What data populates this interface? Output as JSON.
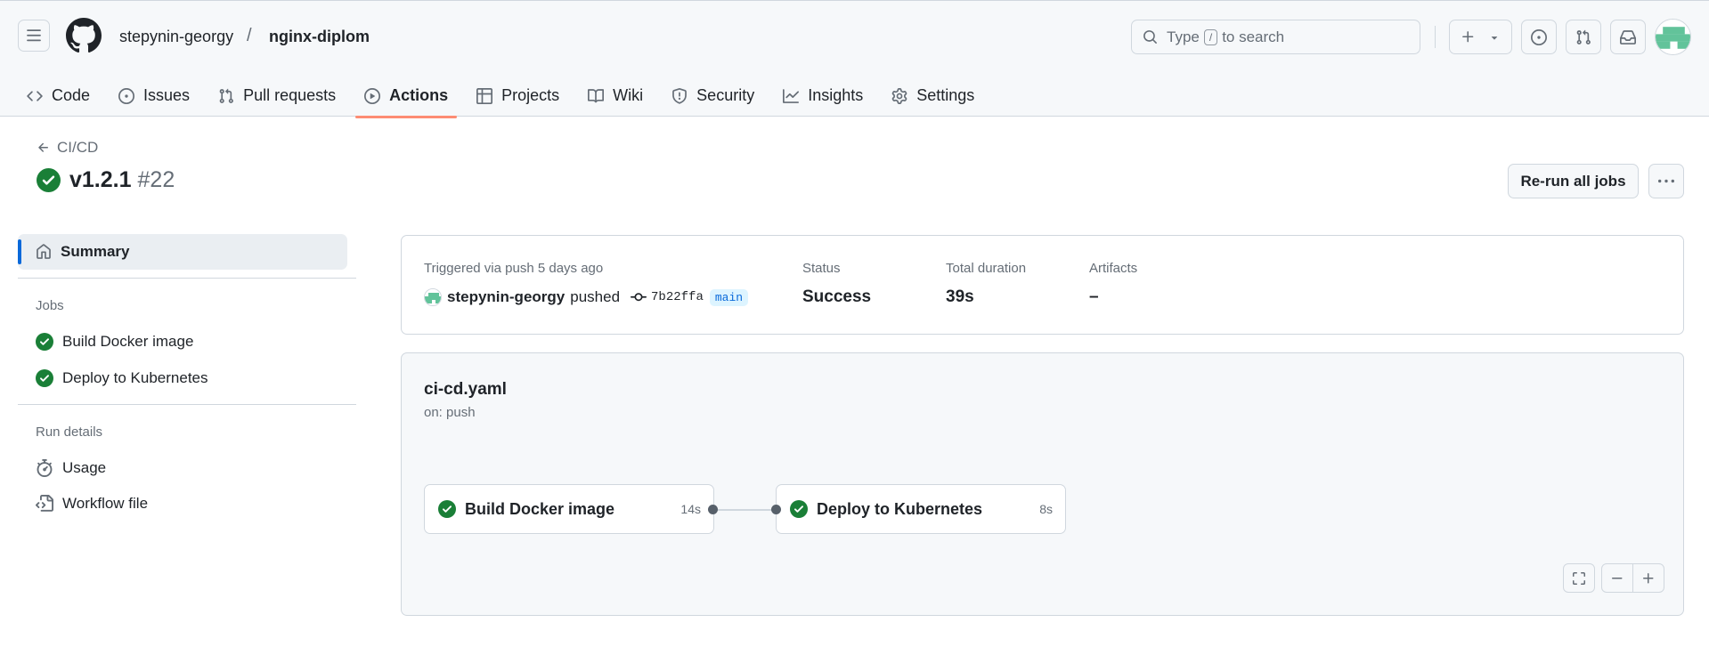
{
  "header": {
    "owner": "stepynin-georgy",
    "separator": "/",
    "repo": "nginx-diplom",
    "search": {
      "prefix": "Type",
      "key": "/",
      "suffix": "to search"
    }
  },
  "tabs": [
    {
      "label": "Code",
      "icon": "code-icon"
    },
    {
      "label": "Issues",
      "icon": "issue-opened-icon"
    },
    {
      "label": "Pull requests",
      "icon": "git-pull-request-icon"
    },
    {
      "label": "Actions",
      "icon": "play-icon",
      "active": true
    },
    {
      "label": "Projects",
      "icon": "table-icon"
    },
    {
      "label": "Wiki",
      "icon": "book-icon"
    },
    {
      "label": "Security",
      "icon": "shield-icon"
    },
    {
      "label": "Insights",
      "icon": "graph-icon"
    },
    {
      "label": "Settings",
      "icon": "gear-icon"
    }
  ],
  "run": {
    "back_label": "CI/CD",
    "name": "v1.2.1",
    "number": "#22",
    "rerun_label": "Re-run all jobs"
  },
  "sidebar": {
    "summary_label": "Summary",
    "jobs_heading": "Jobs",
    "jobs": [
      {
        "label": "Build Docker image",
        "status": "success"
      },
      {
        "label": "Deploy to Kubernetes",
        "status": "success"
      }
    ],
    "details_heading": "Run details",
    "details": [
      {
        "label": "Usage",
        "icon": "stopwatch-icon"
      },
      {
        "label": "Workflow file",
        "icon": "file-code-icon"
      }
    ]
  },
  "summary": {
    "triggered_label": "Triggered via push 5 days ago",
    "user": "stepynin-georgy",
    "verb": "pushed",
    "commit_sha": "7b22ffa",
    "branch": "main",
    "status_label": "Status",
    "status_value": "Success",
    "duration_label": "Total duration",
    "duration_value": "39s",
    "artifacts_label": "Artifacts",
    "artifacts_value": "–"
  },
  "graph": {
    "workflow_file": "ci-cd.yaml",
    "trigger": "on: push",
    "jobs": [
      {
        "name": "Build Docker image",
        "duration": "14s",
        "status": "success"
      },
      {
        "name": "Deploy to Kubernetes",
        "duration": "8s",
        "status": "success"
      }
    ]
  },
  "colors": {
    "success": "#1a7f37",
    "accent": "#0969da",
    "active_tab_underline": "#fd8c73"
  }
}
